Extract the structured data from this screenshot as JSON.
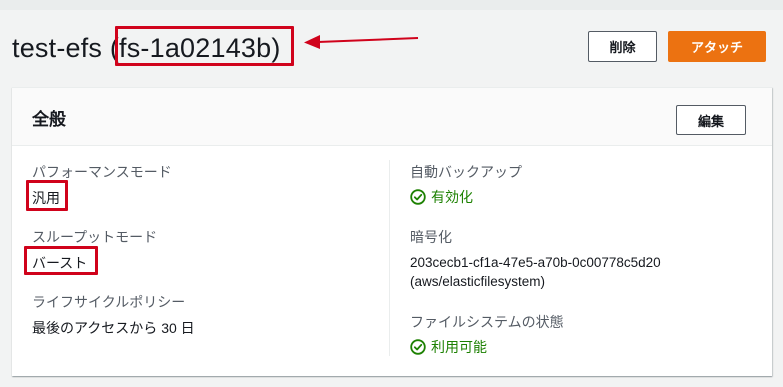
{
  "header": {
    "title_name": "test-efs",
    "title_id": "(fs-1a02143b)",
    "delete_label": "削除",
    "attach_label": "アタッチ"
  },
  "panel": {
    "title": "全般",
    "edit_label": "編集",
    "left": [
      {
        "label": "パフォーマンスモード",
        "value": "汎用"
      },
      {
        "label": "スループットモード",
        "value": "バースト"
      },
      {
        "label": "ライフサイクルポリシー",
        "value": "最後のアクセスから 30 日"
      }
    ],
    "right": {
      "backup": {
        "label": "自動バックアップ",
        "value": "有効化"
      },
      "encryption": {
        "label": "暗号化",
        "key_id": "203cecb1-cf1a-47e5-a70b-0c00778c5d20",
        "alias": "(aws/elasticfilesystem)"
      },
      "state": {
        "label": "ファイルシステムの状態",
        "value": "利用可能"
      }
    }
  },
  "colors": {
    "primary": "#ec7211",
    "success": "#1d8102",
    "annotation": "#d0021b"
  },
  "icons": {
    "success": "status-positive-icon",
    "annotation_arrow": "arrow-left-icon"
  }
}
